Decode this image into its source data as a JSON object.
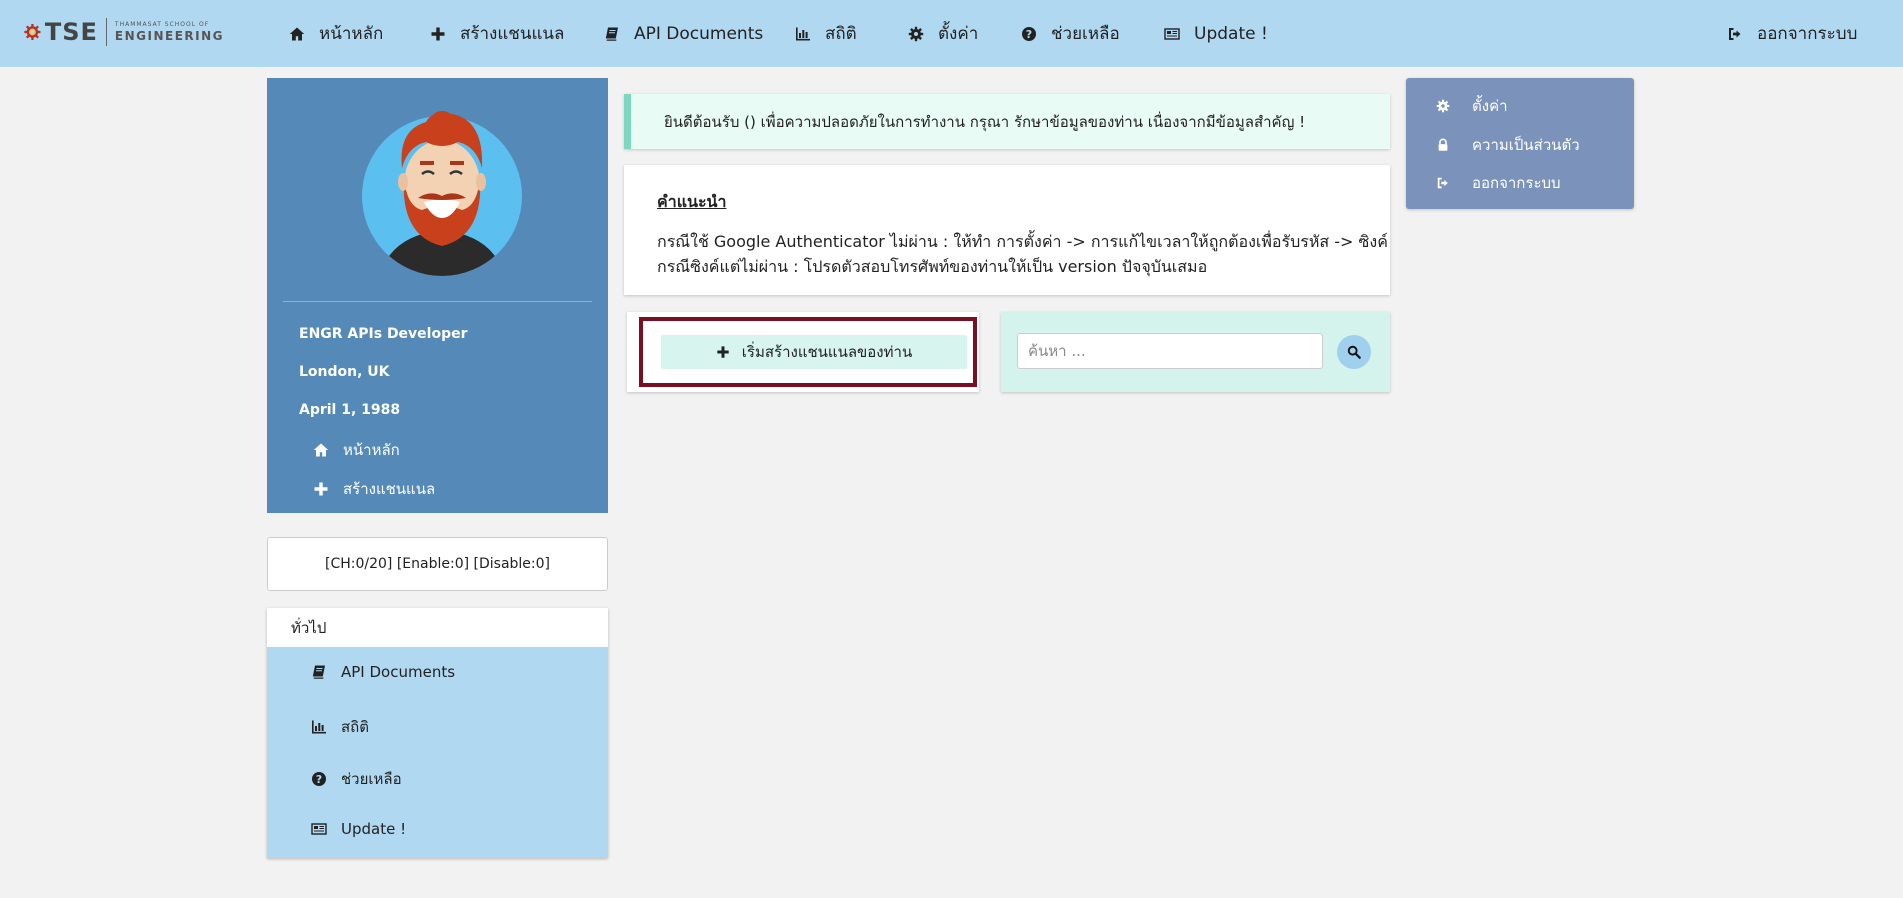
{
  "logo": {
    "main": "TSE",
    "sub_top": "THAMMASAT SCHOOL OF",
    "sub_bottom": "ENGINEERING"
  },
  "topnav": {
    "home": "หน้าหลัก",
    "create_channel": "สร้างแชนแนล",
    "api_documents": "API Documents",
    "stats": "สถิติ",
    "settings": "ตั้งค่า",
    "help": "ช่วยเหลือ",
    "update": "Update !",
    "logout": "ออกจากระบบ"
  },
  "profile": {
    "role": "ENGR APIs Developer",
    "location": "London, UK",
    "birthdate": "April 1, 1988",
    "links": {
      "home": "หน้าหลัก",
      "create_channel": "สร้างแชนแนล"
    }
  },
  "counts": "[CH:0/20] [Enable:0] [Disable:0]",
  "general": {
    "heading": "ทั่วไป",
    "items": {
      "api_documents": "API Documents",
      "stats": "สถิติ",
      "help": "ช่วยเหลือ",
      "update": "Update !"
    }
  },
  "alert": "ยินดีต้อนรับ () เพื่อความปลอดภัยในการทำงาน กรุณา รักษาข้อมูลของท่าน เนื่องจากมีข้อมูลสำคัญ !",
  "advice": {
    "title": "คำแนะนำ",
    "line1": "กรณีใช้ Google Authenticator ไม่ผ่าน : ให้ทำ การตั้งค่า -> การแก้ไขเวลาให้ถูกต้องเพื่อรับรหัส -> ซิงค์",
    "line2": "กรณีซิงค์แต่ไม่ผ่าน : โปรดตัวสอบโทรศัพท์ของท่านให้เป็น version ปัจจุบันเสมอ"
  },
  "create": {
    "label": "เริ่มสร้างแชนแนลของท่าน"
  },
  "search": {
    "placeholder": "ค้นหา ..."
  },
  "rightmenu": {
    "settings": "ตั้งค่า",
    "privacy": "ความเป็นส่วนตัว",
    "logout": "ออกจากระบบ"
  },
  "colors": {
    "topnav_bg": "#b0d8f1",
    "profile_bg": "#558ab8",
    "general_list_bg": "#b0d8f1",
    "alert_bg": "#e9fbf5",
    "alert_border": "#7ed8c0",
    "create_frame": "#7a0f24",
    "search_panel_bg": "#d5f3ed",
    "rightmenu_bg": "#7b93ba",
    "logo_gear": "#b3302c"
  },
  "icons": {
    "home": "home-icon",
    "create": "plus-icon",
    "api": "book-icon",
    "stats": "bar-chart-icon",
    "settings": "gear-icon",
    "help": "question-circle-icon",
    "update": "newspaper-icon",
    "logout": "sign-out-icon",
    "privacy": "lock-icon",
    "search": "search-icon"
  }
}
